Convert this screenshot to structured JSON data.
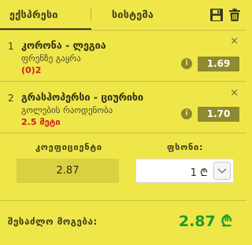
{
  "tabs": {
    "express_label": "ექსპრესი",
    "system_label": "სისტემა"
  },
  "toolbar": {
    "save_icon": "floppy-disk-icon",
    "delete_icon": "trash-icon"
  },
  "bets": [
    {
      "index": "1",
      "match": "კორონა - ლეგია",
      "market": "ფრენზე გაყრა",
      "pick": "(0)2",
      "odds": "1.69",
      "close": "×",
      "info": "i"
    },
    {
      "index": "2",
      "match": "გრასჰოპერსი - ციურიხი",
      "market": "გოლების რაოდენობა",
      "pick": "2.5 მეტი",
      "odds": "1.70",
      "close": "×",
      "info": "i"
    }
  ],
  "stake": {
    "coefficient_label": "კოეფიციენტი",
    "coefficient_value": "2.87",
    "stake_label": "ფსონი:",
    "stake_value": "1 ₾"
  },
  "winnings": {
    "label": "შესაძლო მოგება:",
    "value": "2.87 ₾"
  },
  "colors": {
    "background": "#efe74a",
    "odds_bg": "#8e8a2d",
    "pick_red": "#d41c1c",
    "win_green": "#1c9b2a"
  }
}
